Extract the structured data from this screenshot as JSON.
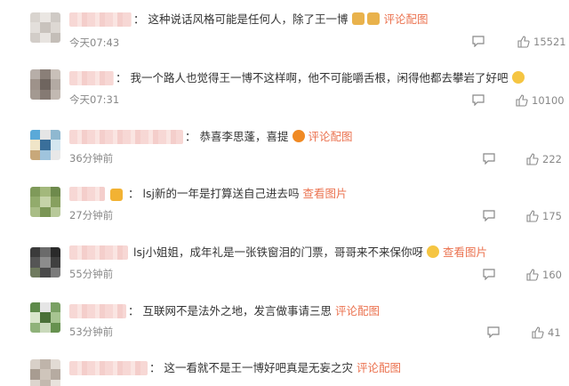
{
  "comments": [
    {
      "separator": "：",
      "text": "这种说话风格可能是任何人，除了王一博",
      "emoji": [
        "doge-icon",
        "doge-icon"
      ],
      "link": "评论配图",
      "time": "今天07:43",
      "likes": "15521"
    },
    {
      "separator": "：",
      "text": "我一个路人也觉得王一博不这样啊，他不可能嚼舌根，闲得他都去攀岩了好吧",
      "emoji": [
        "laugh-icon"
      ],
      "link": "",
      "time": "今天07:31",
      "likes": "10100"
    },
    {
      "separator": "：",
      "text": "恭喜李思蓬，喜提",
      "emoji": [
        "orange-icon"
      ],
      "link": "评论配图",
      "time": "36分钟前",
      "likes": "222"
    },
    {
      "separator": "：",
      "text": "lsj新的一年是打算送自己进去吗",
      "emoji": [],
      "link": "查看图片",
      "time": "27分钟前",
      "likes": "175"
    },
    {
      "separator": "",
      "text": "lsj小姐姐，成年礼是一张铁窗泪的门票，哥哥来不来保你呀",
      "emoji": [
        "tears-icon"
      ],
      "link": "查看图片",
      "time": "55分钟前",
      "likes": "160"
    },
    {
      "separator": "：",
      "text": "互联网不是法外之地，发言做事请三思",
      "emoji": [],
      "link": "评论配图",
      "time": "53分钟前",
      "likes": "41"
    },
    {
      "separator": "：",
      "text": "这一看就不是王一博好吧真是无妄之灾",
      "emoji": [],
      "link": "评论配图",
      "time": "",
      "likes": ""
    }
  ],
  "colors": {
    "link": "#eb7350",
    "text": "#333333",
    "meta": "#888888"
  }
}
